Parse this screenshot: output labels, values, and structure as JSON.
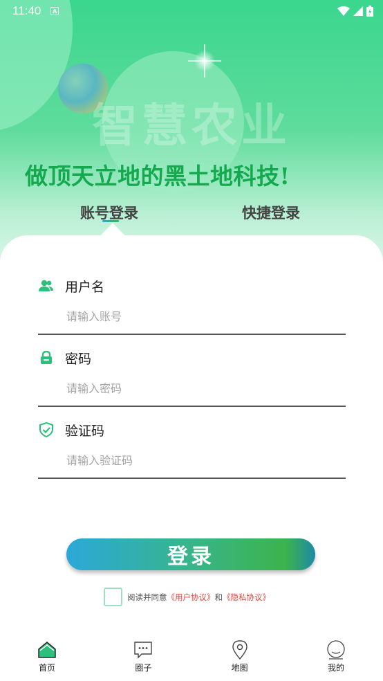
{
  "status_bar": {
    "time": "11:40",
    "indicator_letter": "A"
  },
  "hero": {
    "watermark": "智慧农业",
    "slogan": "做顶天立地的黑土地科技!"
  },
  "tabs": [
    {
      "label": "账号登录",
      "active": true
    },
    {
      "label": "快捷登录",
      "active": false
    }
  ],
  "form": {
    "username": {
      "label": "用户名",
      "placeholder": "请输入账号",
      "icon": "users-icon"
    },
    "password": {
      "label": "密码",
      "placeholder": "请输入密码",
      "icon": "lock-icon"
    },
    "captcha": {
      "label": "验证码",
      "placeholder": "请输入验证码",
      "icon": "shield-check-icon"
    }
  },
  "login_button": {
    "label": "登录"
  },
  "agreement": {
    "checked": false,
    "prefix": "阅读并同意",
    "user_agreement": "《用户协议》",
    "and": "和",
    "privacy_policy": "《隐私协议》"
  },
  "bottom_nav": [
    {
      "label": "首页",
      "icon": "home-icon",
      "active": true
    },
    {
      "label": "圈子",
      "icon": "chat-icon",
      "active": false
    },
    {
      "label": "地图",
      "icon": "map-pin-icon",
      "active": false
    },
    {
      "label": "我的",
      "icon": "profile-icon",
      "active": false
    }
  ],
  "colors": {
    "brand_green": "#3ad68e",
    "slogan_green": "#14a94e",
    "icon_green": "#2cc07a",
    "link_red": "#e0463a",
    "button_gradient_start": "#2ba8d9",
    "button_gradient_end": "#3cb34c"
  }
}
